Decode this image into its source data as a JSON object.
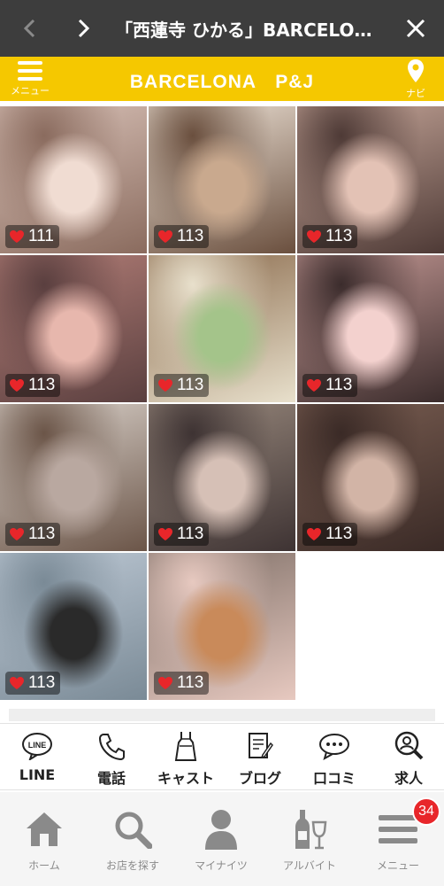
{
  "topbar": {
    "title": "「西蓮寺 ひかる」BARCELONA P&J"
  },
  "header": {
    "menu_label": "メニュー",
    "brand": "BARCELONA　P&J",
    "navi_label": "ナビ"
  },
  "photos": [
    {
      "likes": "111",
      "colors": [
        "#d9c2b8",
        "#8a6b5e",
        "#f0dcd2"
      ]
    },
    {
      "likes": "113",
      "colors": [
        "#efe4d8",
        "#6a4f3e",
        "#c9a98e"
      ]
    },
    {
      "likes": "113",
      "colors": [
        "#c7a79a",
        "#4e3a36",
        "#e3c2b5"
      ]
    },
    {
      "likes": "113",
      "colors": [
        "#b47f78",
        "#5a3f3f",
        "#e7b7ad"
      ]
    },
    {
      "likes": "113",
      "colors": [
        "#8a6a4c",
        "#e8e0cc",
        "#a4c48a"
      ]
    },
    {
      "likes": "113",
      "colors": [
        "#c69a96",
        "#3b2c2c",
        "#f3d1ce"
      ]
    },
    {
      "likes": "113",
      "colors": [
        "#dcd4cd",
        "#6b5548",
        "#b9a8a0"
      ]
    },
    {
      "likes": "113",
      "colors": [
        "#9a8a7e",
        "#3e3333",
        "#d6c0b6"
      ]
    },
    {
      "likes": "113",
      "colors": [
        "#7a5e52",
        "#3a2a26",
        "#d2b4a6"
      ]
    },
    {
      "likes": "113",
      "colors": [
        "#bfcad6",
        "#7a8a96",
        "#2a2a2a"
      ]
    },
    {
      "likes": "113",
      "colors": [
        "#7d6e66",
        "#e7c9c0",
        "#c98a5a"
      ]
    }
  ],
  "shop_menu": [
    {
      "label": "LINE",
      "icon": "line-icon"
    },
    {
      "label": "電話",
      "icon": "phone-icon"
    },
    {
      "label": "キャスト",
      "icon": "dress-icon"
    },
    {
      "label": "ブログ",
      "icon": "blog-icon"
    },
    {
      "label": "口コミ",
      "icon": "chat-icon"
    },
    {
      "label": "求人",
      "icon": "search-person-icon"
    }
  ],
  "tabbar": {
    "items": [
      {
        "label": "ホーム",
        "icon": "home-icon"
      },
      {
        "label": "お店を探す",
        "icon": "search-icon"
      },
      {
        "label": "マイナイツ",
        "icon": "person-icon"
      },
      {
        "label": "アルバイト",
        "icon": "bottle-icon"
      },
      {
        "label": "メニュー",
        "icon": "menu-icon"
      }
    ],
    "badge_count": "34"
  },
  "colors": {
    "topbar_bg": "#3d3d3d",
    "header_accent": "#f5c800",
    "like_heart": "#e8262a",
    "badge": "#e8262a"
  }
}
